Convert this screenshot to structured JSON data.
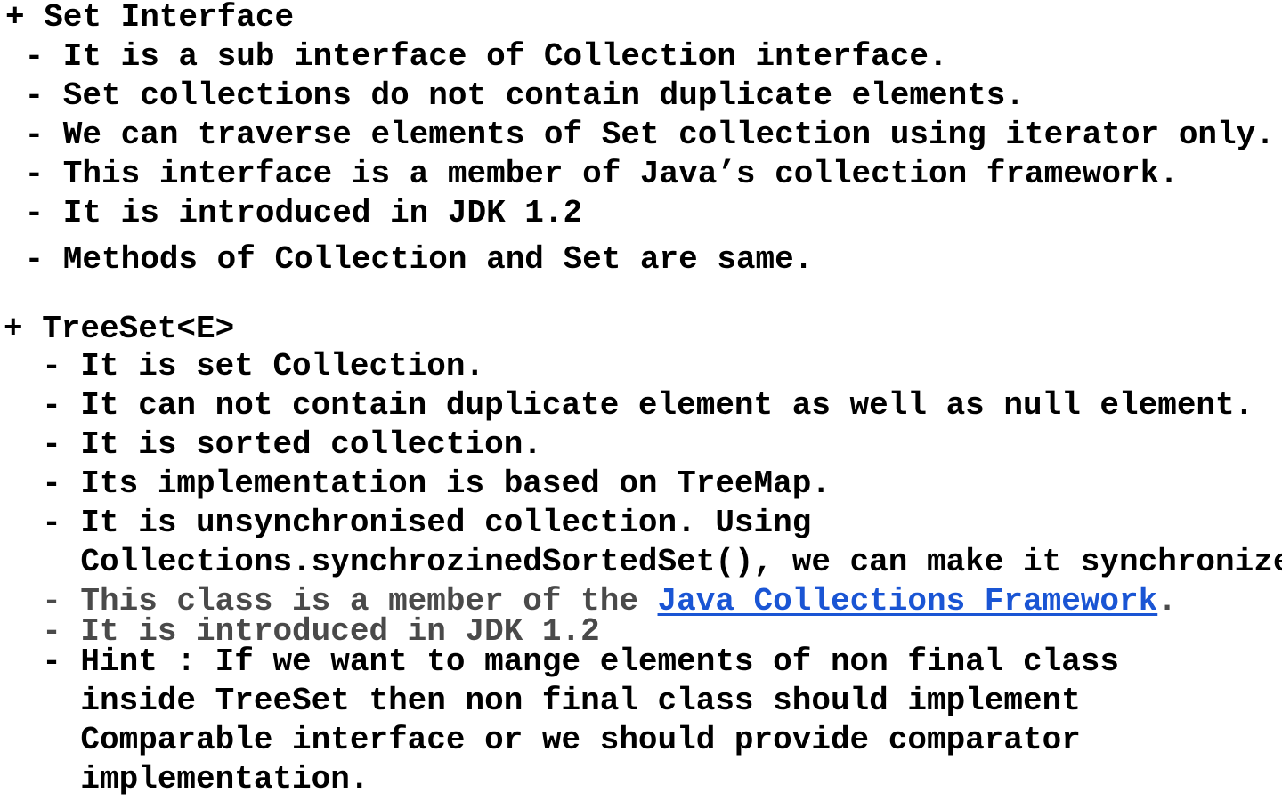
{
  "set_interface": {
    "heading": "+ Set Interface",
    "points": [
      " - It is a sub interface of Collection interface.",
      " - Set collections do not contain duplicate elements.",
      " - We can traverse elements of Set collection using iterator only.",
      " - This interface is a member of Java’s collection framework.",
      " - It is introduced in JDK 1.2",
      " - Methods of Collection and Set are same."
    ]
  },
  "treeset": {
    "heading": "+ TreeSet<E>",
    "points": [
      "  - It is set Collection.",
      "  - It can not contain duplicate element as well as null element.",
      "  - It is sorted collection.",
      "  - Its implementation is based on TreeMap.",
      "  - It is unsynchronised collection. Using",
      "    Collections.synchrozinedSortedSet(), we can make it synchronized."
    ],
    "member_prefix": "  - This class is a member of the ",
    "member_link": "Java Collections Framework",
    "member_suffix": ".",
    "jdk_line": "  - It is introduced in JDK 1.2",
    "hint_lines": [
      "  - Hint : If we want to mange elements of non final class",
      "    inside TreeSet then non final class should implement",
      "    Comparable interface or we should provide comparator",
      "    implementation."
    ]
  }
}
